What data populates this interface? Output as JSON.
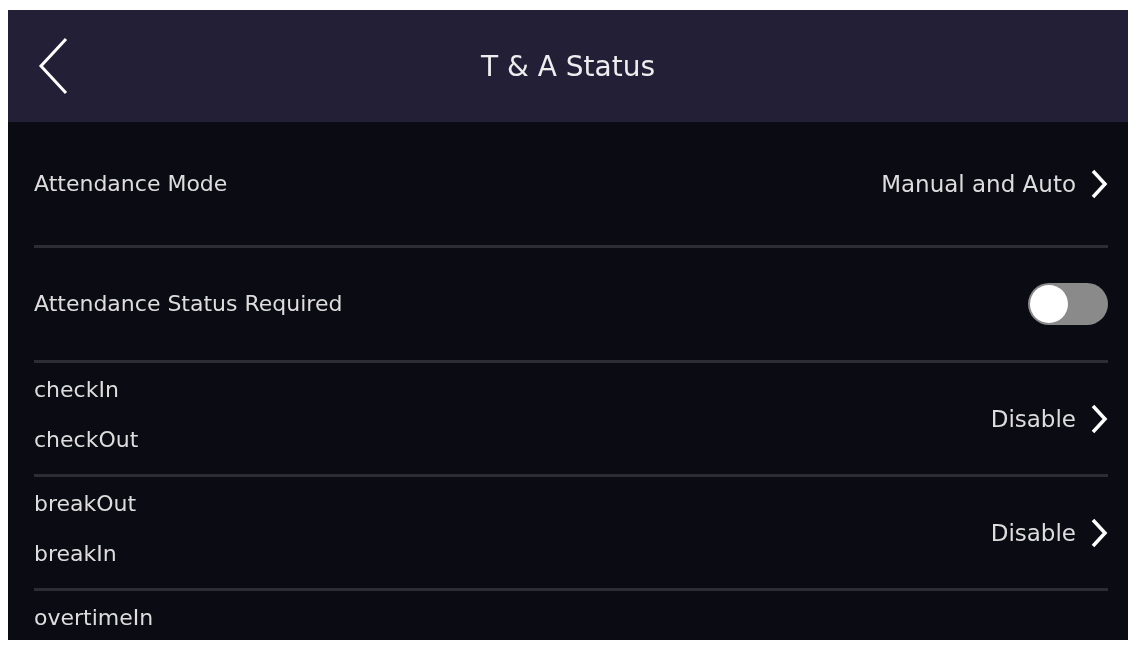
{
  "header": {
    "title": "T & A Status"
  },
  "rows": [
    {
      "kind": "value",
      "label": "Attendance Mode",
      "value": "Manual and Auto"
    },
    {
      "kind": "toggle",
      "label": "Attendance Status Required",
      "on": false
    },
    {
      "kind": "pair",
      "labels": [
        "checkIn",
        "checkOut"
      ],
      "value": "Disable"
    },
    {
      "kind": "pair",
      "labels": [
        "breakOut",
        "breakIn"
      ],
      "value": "Disable"
    },
    {
      "kind": "pair",
      "labels": [
        "overtimeIn"
      ]
    }
  ]
}
